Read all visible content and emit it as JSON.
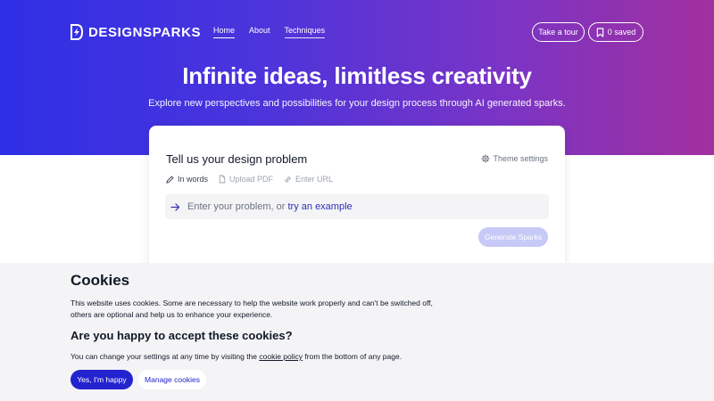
{
  "header": {
    "brand": "DESIGNSPARKS",
    "nav": [
      {
        "label": "Home"
      },
      {
        "label": "About"
      },
      {
        "label": "Techniques"
      }
    ],
    "tour_label": "Take a tour",
    "saved_label": "0 saved"
  },
  "hero": {
    "title": "Infinite ideas, limitless creativity",
    "subtitle": "Explore new perspectives and possibilities for your design process through AI generated sparks."
  },
  "card": {
    "title": "Tell us your design problem",
    "theme_label": "Theme settings",
    "tabs": [
      {
        "label": "In words",
        "icon": "pencil-icon"
      },
      {
        "label": "Upload PDF",
        "icon": "file-icon"
      },
      {
        "label": "Enter URL",
        "icon": "link-icon"
      }
    ],
    "input": {
      "placeholder": "Enter your problem, or ",
      "example_link": "try an example"
    },
    "generate_label": "Generate Sparks"
  },
  "cookies": {
    "title": "Cookies",
    "body": "This website uses cookies. Some are necessary to help the website work properly and can't be switched off, others are optional and help us to enhance your experience.",
    "question": "Are you happy to accept these cookies?",
    "settings_before": "You can change your settings at any time by visiting the ",
    "settings_link": "cookie policy",
    "settings_after": " from the bottom of any page.",
    "accept_label": "Yes, I'm happy",
    "manage_label": "Manage cookies"
  },
  "colors": {
    "accent": "#2323cf",
    "gradient_start": "#2f2fe6",
    "gradient_end": "#a2309e",
    "generate_disabled": "#c7c9f6"
  }
}
